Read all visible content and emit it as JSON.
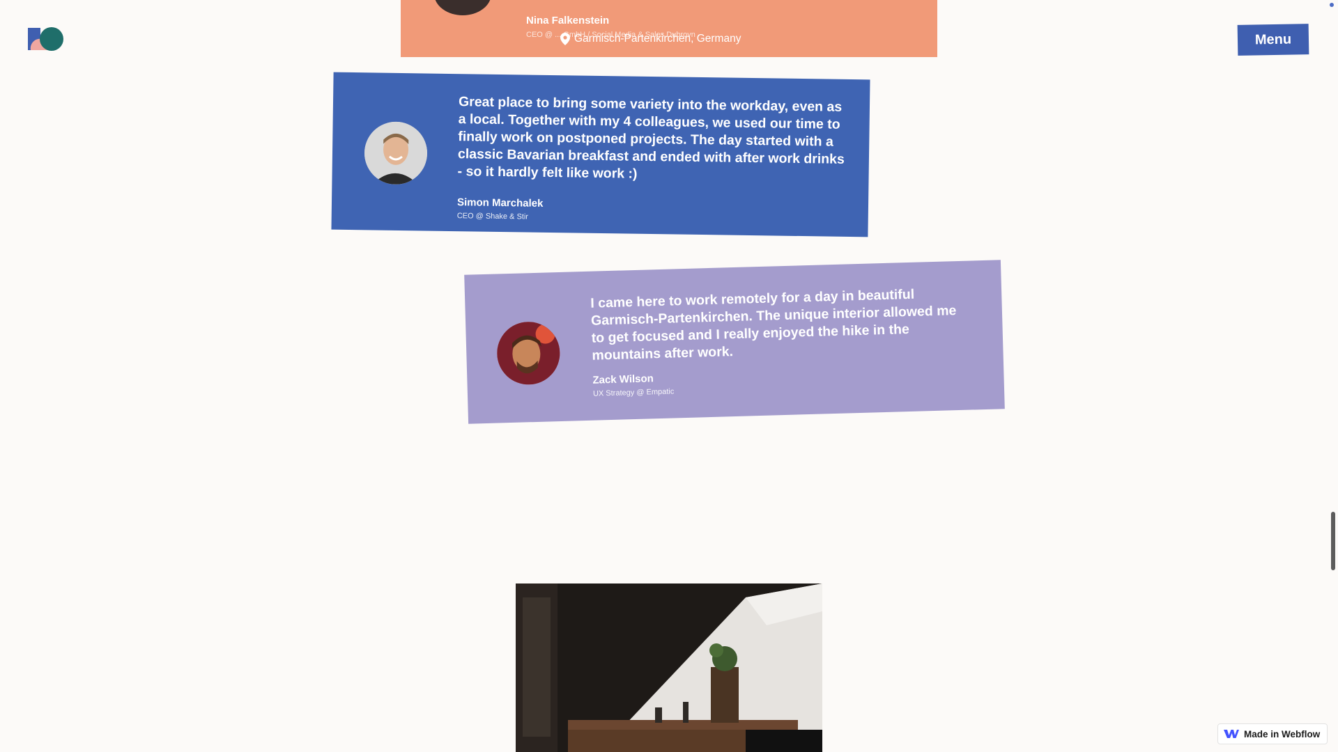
{
  "header": {
    "logo": "site-logo",
    "menu_label": "Menu"
  },
  "testimonials": [
    {
      "name": "Nina Falkenstein",
      "role": "CEO @ ... GmbH / Social Media & Sales Dubrovn",
      "color": "#f19a78"
    },
    {
      "quote": "Great place to bring some variety into the workday, even as a local. Together with my 4 colleagues, we used our time to finally work on postponed projects. The day started with a classic Bavarian breakfast and ended with after work drinks - so it hardly felt like work :)",
      "name": "Simon Marchalek",
      "role": "CEO @ Shake & Stir",
      "color": "#3f64b3"
    },
    {
      "quote": "I came here to work remotely for a day in beautiful Garmisch-Partenkirchen. The unique interior allowed me to get focused and I really enjoyed the hike in the mountains after work.",
      "name": "Zack Wilson",
      "role": "UX Strategy @ Empatic",
      "color": "#a49ccd"
    }
  ],
  "location": {
    "icon": "map-pin-icon",
    "text": "Garmisch-Partenkirchen, Germany"
  },
  "badge": {
    "icon": "webflow-icon",
    "label": "Made in Webflow"
  },
  "colors": {
    "background": "#fcfaf8",
    "accent_blue": "#3f5fb0"
  }
}
